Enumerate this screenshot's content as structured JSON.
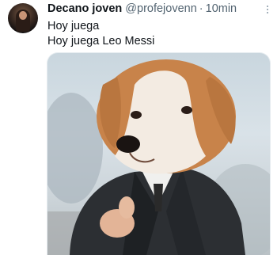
{
  "tweet": {
    "author_name": "Decano joven",
    "author_handle": "@profejovenn",
    "separator": "·",
    "timestamp": "10min",
    "text_lines": [
      "Hoy juega",
      "Hoy juega Leo Messi"
    ]
  },
  "icons": {
    "more": "more-options-icon"
  },
  "colors": {
    "text_primary": "#0f1419",
    "text_secondary": "#536471",
    "background": "#ffffff"
  }
}
